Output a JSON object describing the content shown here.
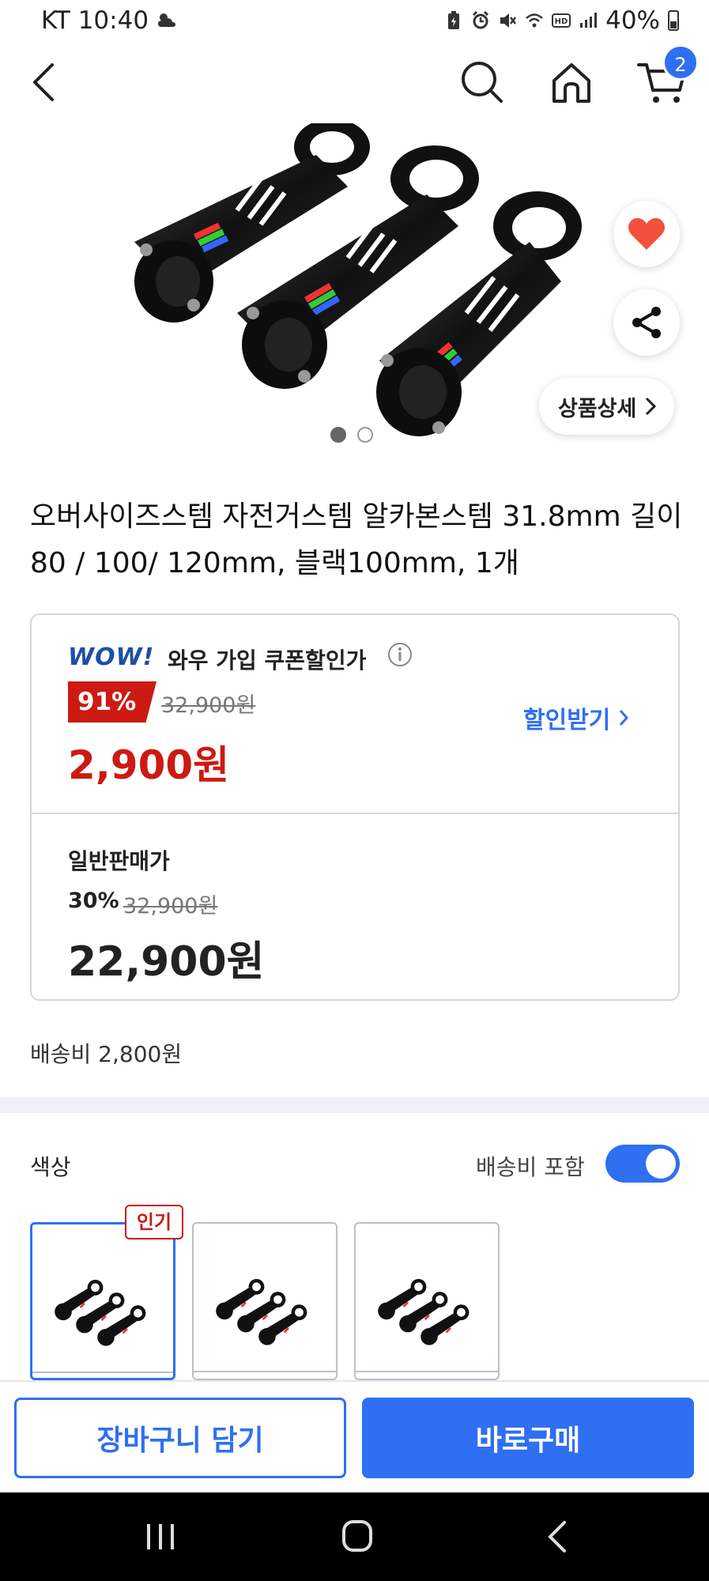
{
  "status_bar": {
    "carrier_time": "KT 10:40",
    "battery": "40%",
    "icons": [
      "weather-icon",
      "battery-saver-icon",
      "alarm-icon",
      "mute-icon",
      "wifi-icon",
      "hd-icon",
      "signal-icon",
      "battery-icon"
    ]
  },
  "header": {
    "icons": [
      "back-icon",
      "search-icon",
      "home-icon",
      "cart-icon"
    ],
    "cart_count": "2"
  },
  "gallery": {
    "detail_button": "상품상세",
    "image_count": 2,
    "active_index": 0
  },
  "product": {
    "title": "오버사이즈스템 자전거스템 알카본스템 31.8mm 길이80 / 100/ 120mm, 블랙100mm, 1개"
  },
  "wow_price": {
    "logo": "WOW!",
    "label": "와우 가입 쿠폰할인가",
    "discount": "91%",
    "original": "32,900원",
    "price": "2,900원",
    "coupon_button": "할인받기"
  },
  "normal_price": {
    "label": "일반판매가",
    "discount": "30%",
    "original": "32,900원",
    "price": "22,900원"
  },
  "shipping": "배송비 2,800원",
  "options": {
    "label": "색상",
    "shipping_toggle_label": "배송비 포함",
    "shipping_toggle_on": true,
    "popular_badge": "인기",
    "selected_index": 0,
    "swatch_count": 3
  },
  "actions": {
    "cart_button": "장바구니 담기",
    "buy_button": "바로구매"
  },
  "colors": {
    "accent": "#2f6ff2",
    "sale_red": "#cc1a12",
    "wow_blue": "#1b4fa8"
  }
}
